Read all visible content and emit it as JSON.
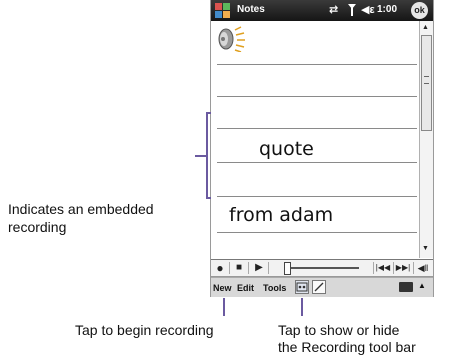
{
  "titlebar": {
    "app_title": "Notes",
    "clock": "1:00",
    "ok_label": "ok"
  },
  "note": {
    "lines": [
      "quote",
      "from adam"
    ]
  },
  "command_bar": {
    "menu_new": "New",
    "menu_edit": "Edit",
    "menu_tools": "Tools"
  },
  "callouts": {
    "embedded_line1": "Indicates an embedded",
    "embedded_line2": "recording",
    "begin_recording": "Tap to begin recording",
    "toggle_line1": "Tap to show or hide",
    "toggle_line2": "the Recording tool bar"
  },
  "icons": [
    "windows-start-icon",
    "sync-icon",
    "signal-icon",
    "speaker-icon",
    "recording-icon",
    "record-icon",
    "stop-icon",
    "play-icon",
    "skip-back-icon",
    "skip-forward-icon",
    "volume-icon",
    "recording-toolbar-icon",
    "pen-icon",
    "keyboard-icon",
    "chevron-up-icon"
  ],
  "colors": {
    "titlebar": "#1e1e1e",
    "bracket": "#6b5aa0"
  }
}
